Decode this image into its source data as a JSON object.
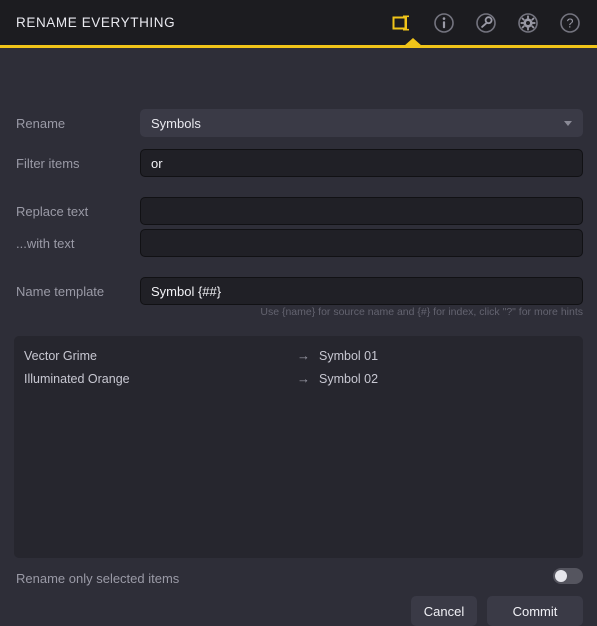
{
  "header": {
    "title": "RENAME EVERYTHING",
    "icons": [
      {
        "name": "rename-tab-icon",
        "glyph": "rename",
        "active": true
      },
      {
        "name": "info-icon",
        "glyph": "info",
        "active": false
      },
      {
        "name": "wrench-icon",
        "glyph": "wrench",
        "active": false
      },
      {
        "name": "gear-icon",
        "glyph": "gear",
        "active": false
      },
      {
        "name": "help-icon",
        "glyph": "question",
        "active": false
      }
    ],
    "accent_color": "#f0c419"
  },
  "form": {
    "rename": {
      "label": "Rename",
      "value": "Symbols",
      "options": [
        "Symbols"
      ]
    },
    "filter_items": {
      "label": "Filter items",
      "value": "or",
      "placeholder": ""
    },
    "replace_text": {
      "label": "Replace text",
      "value": "",
      "placeholder": ""
    },
    "with_text": {
      "label": "...with text",
      "value": "",
      "placeholder": ""
    },
    "name_template": {
      "label": "Name template",
      "value": "Symbol {##}",
      "placeholder": ""
    },
    "hint": "Use {name} for source name and {#} for index, click \"?\" for more hints"
  },
  "preview": {
    "rows": [
      {
        "source": "Vector Grime",
        "arrow": "→",
        "target": "Symbol 01"
      },
      {
        "source": "Illuminated Orange",
        "arrow": "→",
        "target": "Symbol 02"
      }
    ]
  },
  "options": {
    "rename_only_selected": {
      "label": "Rename only selected items",
      "enabled": false
    }
  },
  "actions": {
    "cancel_label": "Cancel",
    "commit_label": "Commit"
  }
}
